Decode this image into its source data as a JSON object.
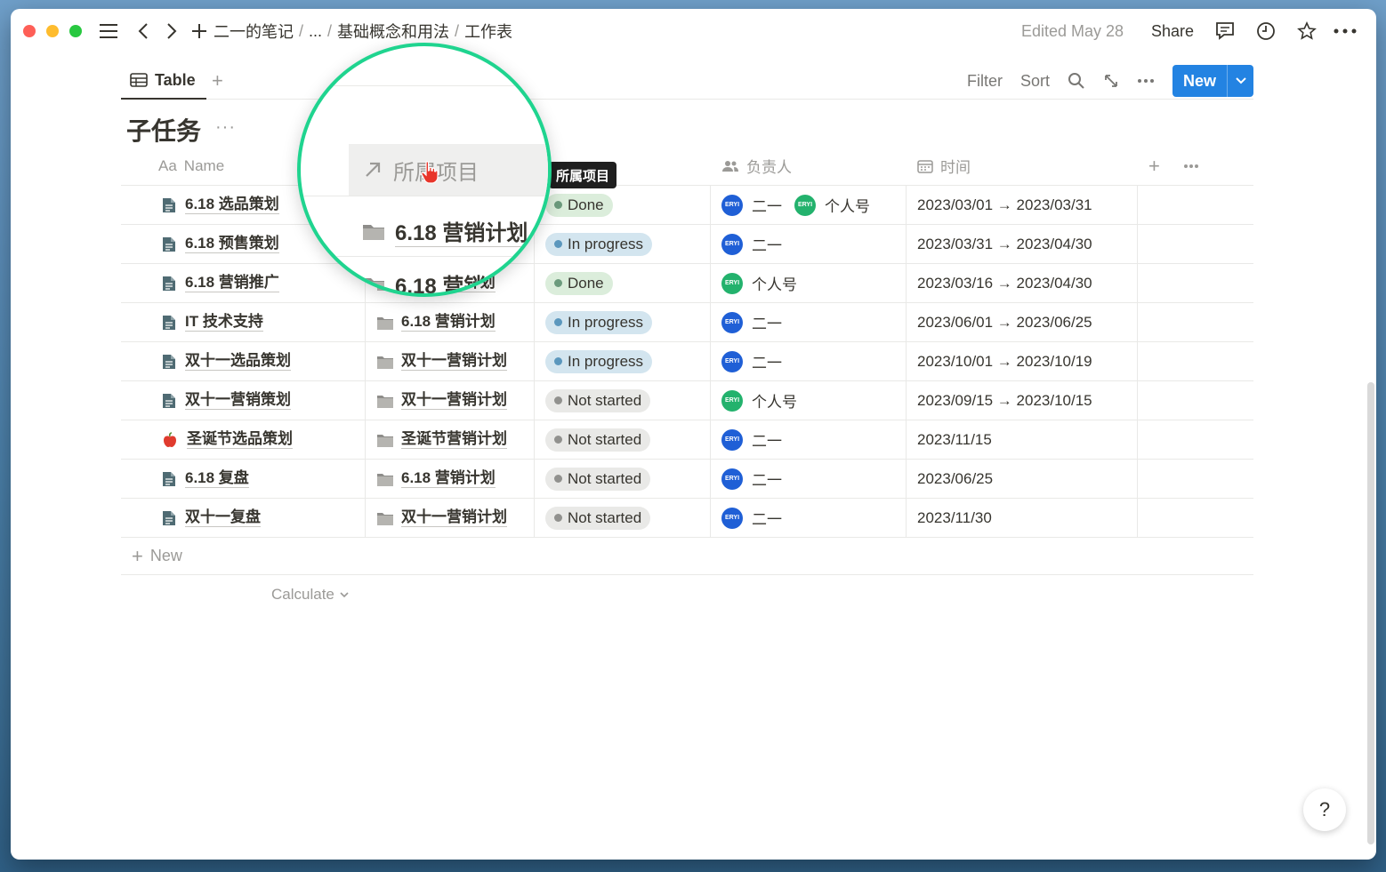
{
  "titlebar": {
    "breadcrumbs": [
      "二一的笔记",
      "...",
      "基础概念和用法",
      "工作表"
    ],
    "edited": "Edited May 28",
    "share": "Share"
  },
  "viewbar": {
    "tab_label": "Table",
    "filter": "Filter",
    "sort": "Sort",
    "new_label": "New"
  },
  "database": {
    "title": "子任务",
    "more": "···"
  },
  "columns": {
    "name": "Name",
    "name_prefix": "Aa",
    "project": "所属项目",
    "status": "",
    "owner": "负责人",
    "time": "时间"
  },
  "tooltip": "所属项目",
  "magnifier": {
    "header": "所属项目",
    "row1": "6.18 营销计划",
    "row2": "6.18 营销"
  },
  "rows": [
    {
      "name": "6.18 选品策划",
      "icon": "doc-icon",
      "project": "6.18 营销计划",
      "status": "Done",
      "owners": [
        "二一",
        "个人号"
      ],
      "time": "2023/03/01 → 2023/03/31"
    },
    {
      "name": "6.18 预售策划",
      "icon": "doc-icon",
      "project": "6.18 营销计划",
      "status": "In progress",
      "owners": [
        "二一"
      ],
      "time": "2023/03/31 → 2023/04/30"
    },
    {
      "name": "6.18 营销推广",
      "icon": "doc-icon",
      "project": "6.18 营销计划",
      "status": "Done",
      "owners": [
        "个人号"
      ],
      "time": "2023/03/16 → 2023/04/30"
    },
    {
      "name": "IT 技术支持",
      "icon": "doc-icon",
      "project": "6.18 营销计划",
      "status": "In progress",
      "owners": [
        "二一"
      ],
      "time": "2023/06/01 → 2023/06/25"
    },
    {
      "name": "双十一选品策划",
      "icon": "doc-icon",
      "project": "双十一营销计划",
      "status": "In progress",
      "owners": [
        "二一"
      ],
      "time": "2023/10/01 → 2023/10/19"
    },
    {
      "name": "双十一营销策划",
      "icon": "doc-icon",
      "project": "双十一营销计划",
      "status": "Not started",
      "owners": [
        "个人号"
      ],
      "time": "2023/09/15 → 2023/10/15"
    },
    {
      "name": "圣诞节选品策划",
      "icon": "apple-icon",
      "project": "圣诞节营销计划",
      "status": "Not started",
      "owners": [
        "二一"
      ],
      "time": "2023/11/15"
    },
    {
      "name": "6.18 复盘",
      "icon": "doc-icon",
      "project": "6.18 营销计划",
      "status": "Not started",
      "owners": [
        "二一"
      ],
      "time": "2023/06/25"
    },
    {
      "name": "双十一复盘",
      "icon": "doc-icon",
      "project": "双十一营销计划",
      "status": "Not started",
      "owners": [
        "二一"
      ],
      "time": "2023/11/30"
    }
  ],
  "status_styles": {
    "Done": {
      "bg": "#dbeddb",
      "dot": "#6c9b7d"
    },
    "In progress": {
      "bg": "#d3e5ef",
      "dot": "#5b97bd"
    },
    "Not started": {
      "bg": "#e9e9e7",
      "dot": "#91918e"
    }
  },
  "owner_colors": {
    "二一": "#1f5fd6",
    "个人号": "#23b26d"
  },
  "avatar_text": "ERYI",
  "add_row": "New",
  "calculate": "Calculate",
  "help": "?"
}
